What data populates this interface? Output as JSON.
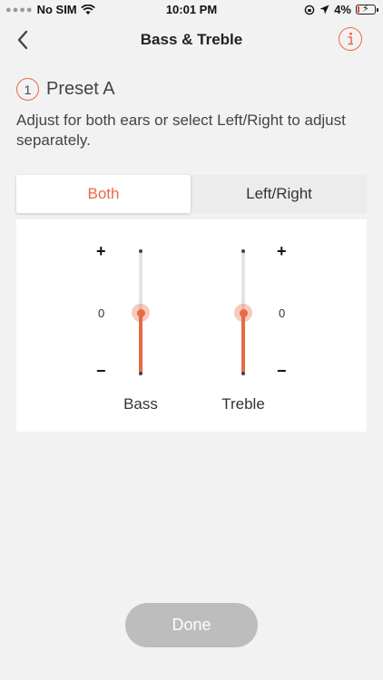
{
  "status_bar": {
    "carrier": "No SIM",
    "time": "10:01 PM",
    "battery": "4%"
  },
  "nav": {
    "title": "Bass & Treble",
    "back_icon": "chevron-left-icon",
    "info_icon": "info-icon"
  },
  "preset": {
    "number": "1",
    "name": "Preset A"
  },
  "description": "Adjust for both ears or select Left/Right to adjust separately.",
  "tabs": [
    {
      "label": "Both",
      "selected": true
    },
    {
      "label": "Left/Right",
      "selected": false
    }
  ],
  "sliders": [
    {
      "label": "Bass",
      "plus": "+",
      "zero": "0",
      "minus": "−",
      "value": 0
    },
    {
      "label": "Treble",
      "plus": "+",
      "zero": "0",
      "minus": "−",
      "value": 0
    }
  ],
  "done_label": "Done",
  "colors": {
    "accent": "#e96b45",
    "done_disabled": "#bdbdbd",
    "background": "#f2f2f2"
  }
}
